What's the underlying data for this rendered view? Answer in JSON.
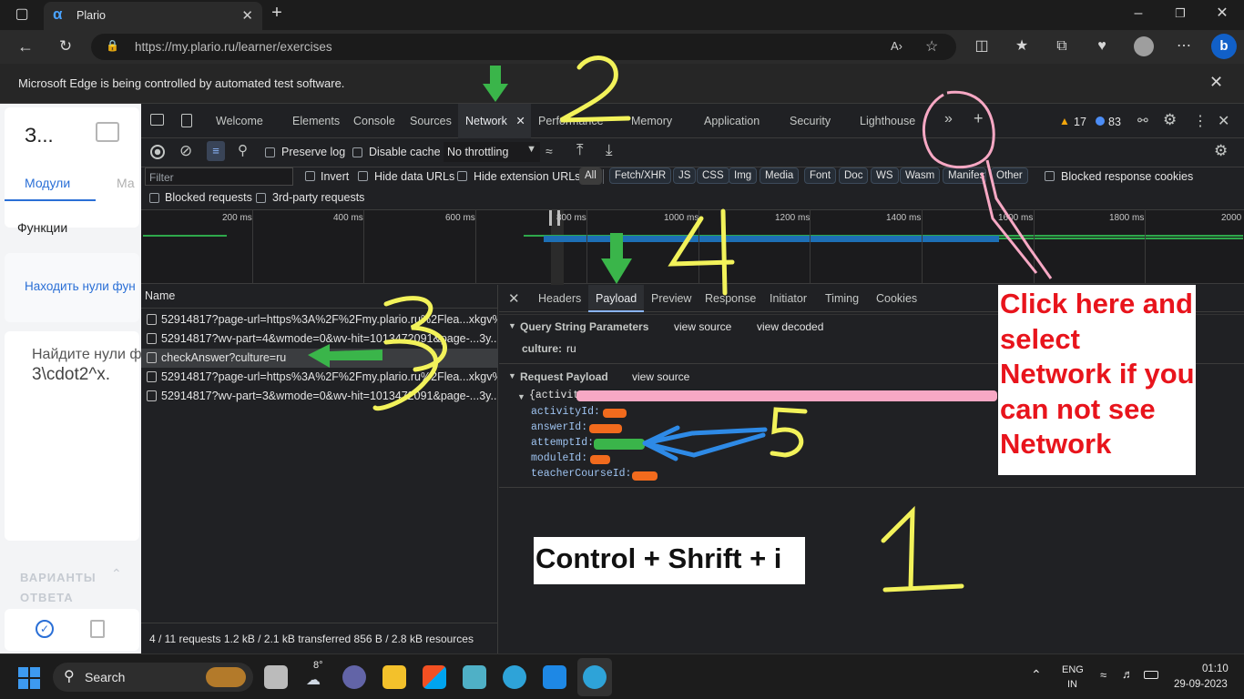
{
  "browser": {
    "tab_title": "Plario",
    "url": "https://my.plario.ru/learner/exercises",
    "automation_notice": "Microsoft Edge is being controlled by automated test software."
  },
  "page": {
    "title_truncated": "З...",
    "tab_modules": "Модули",
    "tab_partial": "Ма",
    "section_label": "Функции",
    "link_text": "Находить нули фун",
    "question_line1": "Найдите нули ф",
    "question_line2": "3\\cdot2^x.",
    "answers_label_1": "ВАРИАНТЫ",
    "answers_label_2": "ОТВЕТА"
  },
  "devtools": {
    "tabs": [
      "Welcome",
      "Elements",
      "Console",
      "Sources",
      "Network",
      "Performance",
      "Memory",
      "Application",
      "Security",
      "Lighthouse"
    ],
    "warnings_count": "17",
    "messages_count": "83",
    "toolbar": {
      "preserve_log": "Preserve log",
      "disable_cache": "Disable cache",
      "throttling": "No throttling"
    },
    "filter": {
      "placeholder": "Filter",
      "invert": "Invert",
      "hide_data_urls": "Hide data URLs",
      "hide_extension_urls": "Hide extension URLs",
      "types": [
        "All",
        "Fetch/XHR",
        "JS",
        "CSS",
        "Img",
        "Media",
        "Font",
        "Doc",
        "WS",
        "Wasm",
        "Manifest",
        "Other"
      ],
      "blocked_response_cookies": "Blocked response cookies",
      "blocked_requests": "Blocked requests",
      "third_party_requests": "3rd-party requests"
    },
    "timeline_ticks": [
      "200 ms",
      "400 ms",
      "600 ms",
      "800 ms",
      "1000 ms",
      "1200 ms",
      "1400 ms",
      "1600 ms",
      "1800 ms",
      "2000"
    ],
    "requests_header": "Name",
    "requests": [
      "52914817?page-url=https%3A%2F%2Fmy.plario.ru%2Flea...xkgv%3...",
      "52914817?wv-part=4&wmode=0&wv-hit=1013472091&page-...3y...",
      "checkAnswer?culture=ru",
      "52914817?page-url=https%3A%2F%2Fmy.plario.ru%2Flea...xkgv%3...",
      "52914817?wv-part=3&wmode=0&wv-hit=1013472091&page-...3y..."
    ],
    "status_bar": "4 / 11 requests  1.2 kB / 2.1 kB transferred  856 B / 2.8 kB resources",
    "detail_tabs": [
      "Headers",
      "Payload",
      "Preview",
      "Response",
      "Initiator",
      "Timing",
      "Cookies"
    ],
    "query_section": {
      "title": "Query String Parameters",
      "view_source": "view source",
      "view_decoded": "view decoded",
      "param_key": "culture:",
      "param_value": "ru"
    },
    "payload_section": {
      "title": "Request Payload",
      "view_source": "view source",
      "object_open": "{activit",
      "fields": [
        "activityId:",
        "answerId:",
        "attemptId:",
        "moduleId:",
        "teacherCourseId:"
      ]
    }
  },
  "annotations": {
    "callout": "Click here and select Network if you can not see Network",
    "shortcut": "Control + Shrift + i",
    "numbers": [
      "1",
      "2",
      "3",
      "4",
      "5"
    ]
  },
  "taskbar": {
    "search": "Search",
    "weather": "8°",
    "lang_top": "ENG",
    "lang_bottom": "IN",
    "time": "01:10",
    "date": "29-09-2023"
  },
  "colors": {
    "annotation_yellow": "#f2f25a",
    "annotation_green": "#3ab54a",
    "annotation_pink": "#f7a8c4",
    "annotation_blue": "#2e8ae6",
    "callout_red": "#e8141c"
  }
}
